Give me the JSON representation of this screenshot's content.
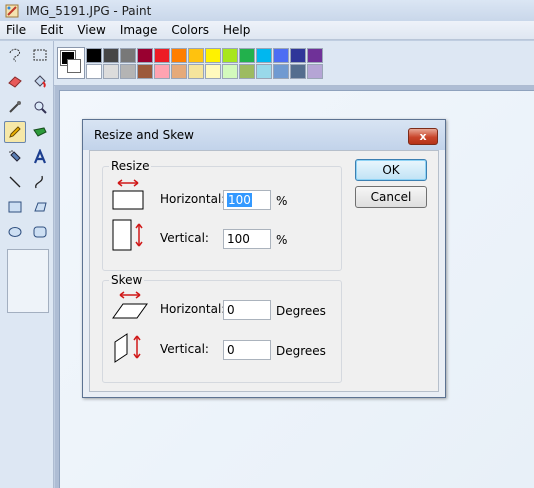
{
  "window": {
    "title": "IMG_5191.JPG - Paint"
  },
  "menu": {
    "items": [
      {
        "id": "file",
        "label": "File"
      },
      {
        "id": "edit",
        "label": "Edit"
      },
      {
        "id": "view",
        "label": "View"
      },
      {
        "id": "image",
        "label": "Image"
      },
      {
        "id": "colors",
        "label": "Colors"
      },
      {
        "id": "help",
        "label": "Help"
      }
    ]
  },
  "tools": [
    {
      "name": "free-form-select-icon",
      "selected": false
    },
    {
      "name": "select-icon",
      "selected": false
    },
    {
      "name": "eraser-icon",
      "selected": false
    },
    {
      "name": "fill-bucket-icon",
      "selected": false
    },
    {
      "name": "color-picker-icon",
      "selected": false
    },
    {
      "name": "magnifier-icon",
      "selected": false
    },
    {
      "name": "pencil-icon",
      "selected": true
    },
    {
      "name": "brush-icon",
      "selected": false
    },
    {
      "name": "airbrush-icon",
      "selected": false
    },
    {
      "name": "text-icon",
      "selected": false
    },
    {
      "name": "line-icon",
      "selected": false
    },
    {
      "name": "curve-icon",
      "selected": false
    },
    {
      "name": "rectangle-icon",
      "selected": false
    },
    {
      "name": "polygon-icon",
      "selected": false
    },
    {
      "name": "ellipse-icon",
      "selected": false
    },
    {
      "name": "rounded-rectangle-icon",
      "selected": false
    }
  ],
  "colors": {
    "foreground": "#000000",
    "background": "#ffffff",
    "palette_row1": [
      "#000000",
      "#464646",
      "#787878",
      "#990030",
      "#ed1c24",
      "#ff7e00",
      "#ffc20e",
      "#fff200",
      "#a8e61d",
      "#22b14c",
      "#00b7ef",
      "#4d6df3",
      "#2f3699",
      "#6f3198"
    ],
    "palette_row2": [
      "#ffffff",
      "#dcdcdc",
      "#b4b4b4",
      "#9c5a3c",
      "#ffa3b1",
      "#e5aa7a",
      "#f5e49c",
      "#fff9bd",
      "#d3f9bc",
      "#9dbb61",
      "#99d9ea",
      "#709ad1",
      "#546d8e",
      "#b5a5d5"
    ]
  },
  "dialog": {
    "title": "Resize and Skew",
    "close_label": "x",
    "resize": {
      "legend": "Resize",
      "horizontal_label": "Horizontal:",
      "horizontal_value": "100",
      "horizontal_unit": "%",
      "vertical_label": "Vertical:",
      "vertical_value": "100",
      "vertical_unit": "%"
    },
    "skew": {
      "legend": "Skew",
      "horizontal_label": "Horizontal:",
      "horizontal_value": "0",
      "horizontal_unit": "Degrees",
      "vertical_label": "Vertical:",
      "vertical_value": "0",
      "vertical_unit": "Degrees"
    },
    "ok_label": "OK",
    "cancel_label": "Cancel"
  }
}
